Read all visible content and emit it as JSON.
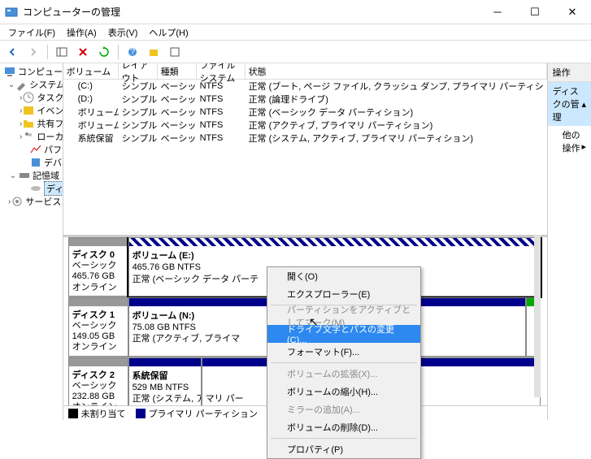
{
  "window": {
    "title": "コンピューターの管理"
  },
  "menubar": [
    "ファイル(F)",
    "操作(A)",
    "表示(V)",
    "ヘルプ(H)"
  ],
  "tree": {
    "root": "コンピューターの管理 (ローカル)",
    "systools": {
      "label": "システム ツール",
      "items": [
        "タスク スケジューラ",
        "イベント ビューアー",
        "共有フォルダー",
        "ローカル ユーザーとグループ",
        "パフォーマンス",
        "デバイス マネージャー"
      ]
    },
    "storage": {
      "label": "記憶域",
      "disk": "ディスクの管理"
    },
    "services": "サービスとアプリケーション"
  },
  "volumes": {
    "headers": {
      "volume": "ボリューム",
      "layout": "レイアウト",
      "type": "種類",
      "fs": "ファイル システム",
      "status": "状態"
    },
    "rows": [
      {
        "volume": "(C:)",
        "layout": "シンプル",
        "type": "ベーシック",
        "fs": "NTFS",
        "status": "正常 (ブート, ページ ファイル, クラッシュ ダンプ, プライマリ パーティシ"
      },
      {
        "volume": "(D:)",
        "layout": "シンプル",
        "type": "ベーシック",
        "fs": "NTFS",
        "status": "正常 (論理ドライブ)"
      },
      {
        "volume": "ボリューム (E:)",
        "layout": "シンプル",
        "type": "ベーシック",
        "fs": "NTFS",
        "status": "正常 (ベーシック データ パーティション)"
      },
      {
        "volume": "ボリューム (N:)",
        "layout": "シンプル",
        "type": "ベーシック",
        "fs": "NTFS",
        "status": "正常 (アクティブ, プライマリ パーティション)"
      },
      {
        "volume": "系統保留",
        "layout": "シンプル",
        "type": "ベーシック",
        "fs": "NTFS",
        "status": "正常 (システム, アクティブ, プライマリ パーティション)"
      }
    ]
  },
  "disks": [
    {
      "name": "ディスク 0",
      "type": "ベーシック",
      "size": "465.76 GB",
      "state": "オンライン",
      "parts": [
        {
          "label": "ボリューム (E:)",
          "info": "465.76 GB NTFS",
          "status": "正常 (ベーシック データ パーテ",
          "bar": "hatched",
          "selected": true
        }
      ]
    },
    {
      "name": "ディスク 1",
      "type": "ベーシック",
      "size": "149.05 GB",
      "state": "オンライン",
      "parts": [
        {
          "label": "ボリューム (N:)",
          "info": "75.08 GB NTFS",
          "status": "正常 (アクティブ, プライマ",
          "bar": "primary"
        },
        {
          "label": "",
          "info": "",
          "status": "",
          "bar": "green",
          "narrow": true
        }
      ]
    },
    {
      "name": "ディスク 2",
      "type": "ベーシック",
      "size": "232.88 GB",
      "state": "オンライン",
      "parts": [
        {
          "label": "系統保留",
          "info": "529 MB NTFS",
          "status": "正常 (システム, アクティブ",
          "bar": "primary",
          "w": 90
        },
        {
          "label": "",
          "info": "",
          "status": "マリ パー",
          "bar": "primary"
        }
      ]
    }
  ],
  "legend": {
    "unalloc": "未割り当て",
    "primary": "プライマリ パーティション"
  },
  "actions": {
    "title": "操作",
    "selected": "ディスクの管理",
    "other": "他の操作"
  },
  "context": [
    {
      "label": "開く(O)"
    },
    {
      "label": "エクスプローラー(E)"
    },
    {
      "sep": true
    },
    {
      "label": "パーティションをアクティブとしてマーク(M)",
      "dis": true
    },
    {
      "label": "ドライブ文字とパスの変更(C)...",
      "hl": true
    },
    {
      "label": "フォーマット(F)..."
    },
    {
      "sep": true
    },
    {
      "label": "ボリュームの拡張(X)...",
      "dis": true
    },
    {
      "label": "ボリュームの縮小(H)..."
    },
    {
      "label": "ミラーの追加(A)...",
      "dis": true
    },
    {
      "label": "ボリュームの削除(D)..."
    },
    {
      "sep": true
    },
    {
      "label": "プロパティ(P)"
    }
  ]
}
